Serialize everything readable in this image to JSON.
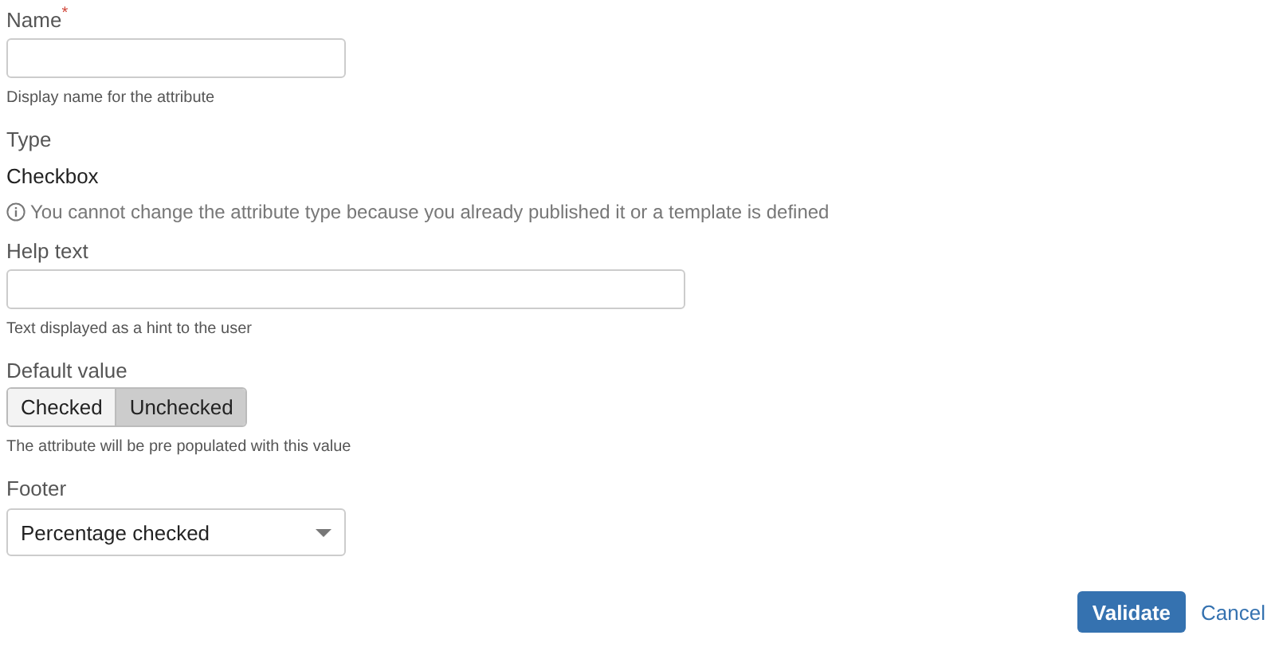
{
  "fields": [
    {
      "kind": "text",
      "label": "Name",
      "required_mark": "*",
      "wide": false,
      "hint": "Display name for the attribute"
    },
    {
      "kind": "static",
      "label": "Type",
      "value": "Checkbox",
      "note": "You cannot change the attribute type because you already published it or a template is defined"
    },
    {
      "kind": "text",
      "label": "Help text",
      "wide": true,
      "hint": "Text displayed as a hint to the user"
    },
    {
      "kind": "toggle",
      "label": "Default value",
      "options": [
        {
          "label": "Checked",
          "selected": false
        },
        {
          "label": "Unchecked",
          "selected": true
        }
      ],
      "hint": "The attribute will be pre populated with this value"
    },
    {
      "kind": "select",
      "label": "Footer",
      "value": "Percentage checked"
    }
  ],
  "actions": {
    "primary": "Validate",
    "cancel": "Cancel"
  }
}
